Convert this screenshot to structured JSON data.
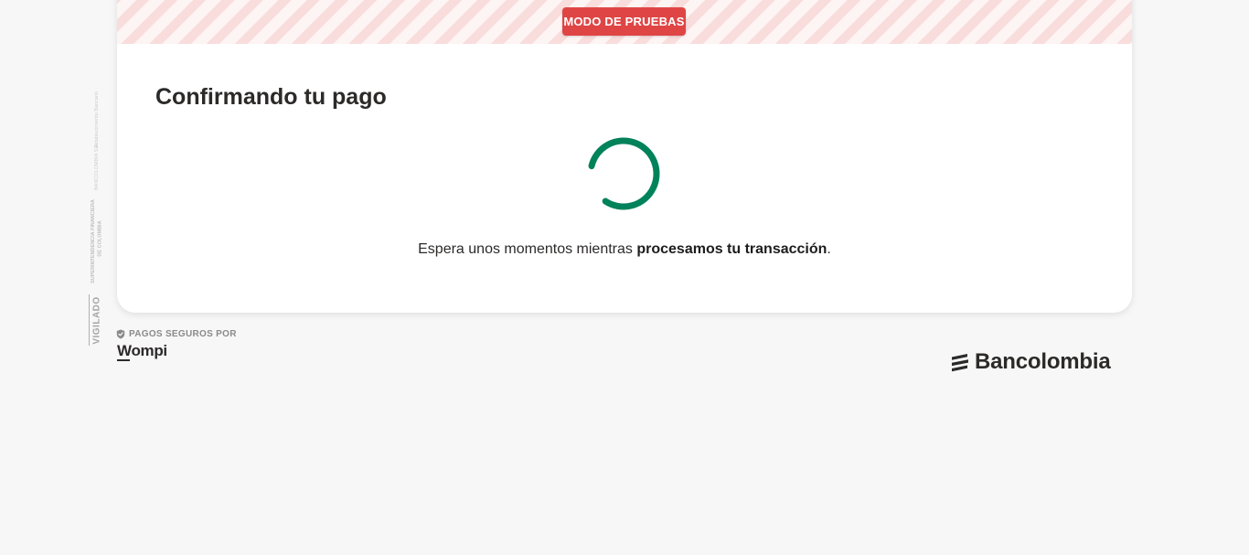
{
  "side_seal": {
    "vigilado": "VIGILADO",
    "superintendencia": "SUPERINTENDENCIA FINANCIERA",
    "de_colombia": "DE COLOMBIA",
    "bancolombia_sa": "BANCOLOMBIA S.A.",
    "establecimiento": "Establecimiento Bancario"
  },
  "test_mode": {
    "badge_label": "MODO DE PRUEBAS",
    "badge_color": "#df4545"
  },
  "card": {
    "title": "Confirmando tu pago",
    "message_prefix": "Espera unos momentos mientras ",
    "message_bold": "procesamos tu transacción",
    "message_suffix": ".",
    "spinner_color": "#00825a"
  },
  "footer": {
    "secure_label": "PAGOS SEGUROS POR",
    "secure_icon": "shield-check-icon",
    "wompi_logo_text": "Wompi",
    "bancolombia_logo_text": "Bancolombia",
    "bancolombia_icon": "bancolombia-stripes-icon"
  }
}
